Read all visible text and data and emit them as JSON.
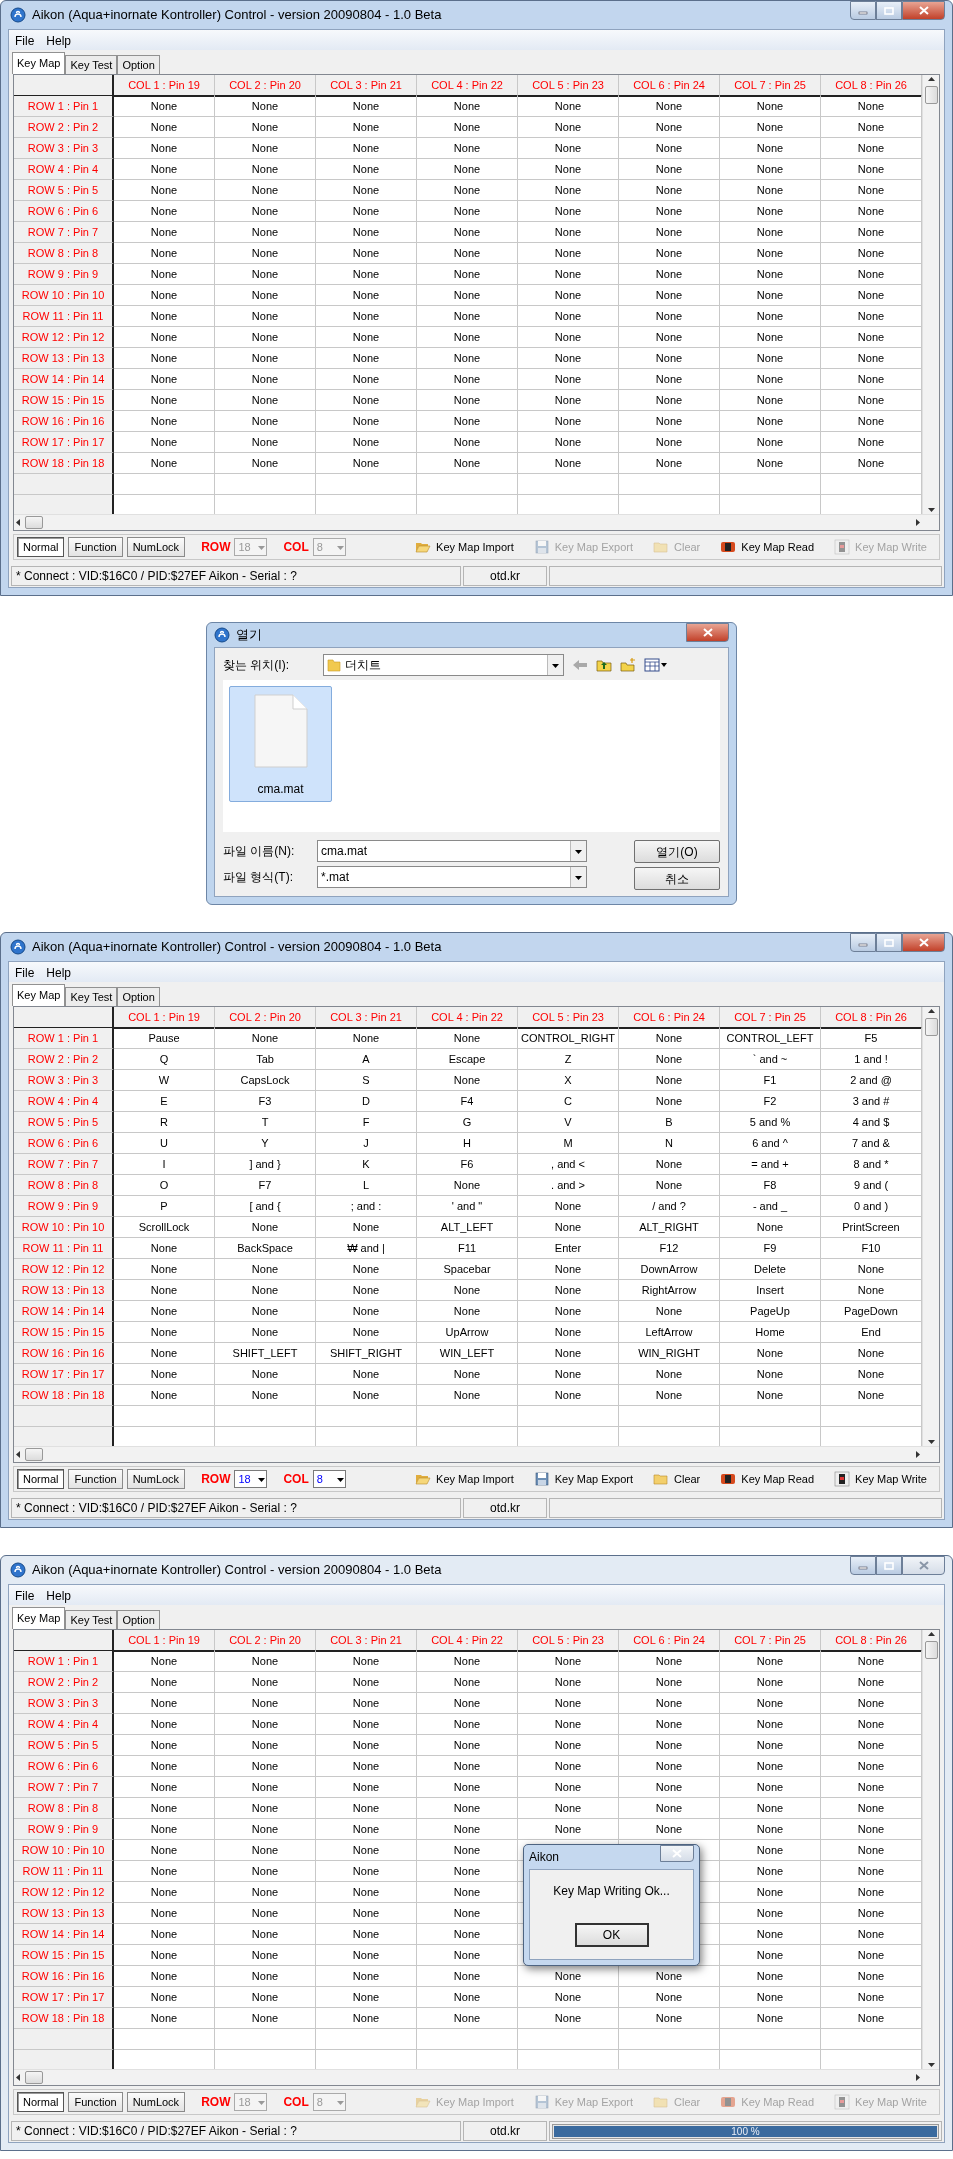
{
  "items": [
    {
      "kind": "window",
      "title": "Aikon (Aqua+inornate Kontroller) Control - version 20090804 - 1.0 Beta",
      "active": true,
      "menu": [
        "File",
        "Help"
      ],
      "tabs": [
        {
          "label": "Key Map",
          "selected": true
        },
        {
          "label": "Key Test",
          "selected": false
        },
        {
          "label": "Option",
          "selected": false
        }
      ],
      "columns": [
        "COL 1 : Pin 19",
        "COL 2 : Pin 20",
        "COL 3 : Pin 21",
        "COL 4 : Pin 22",
        "COL 5 : Pin 23",
        "COL 6 : Pin 24",
        "COL 7 : Pin 25",
        "COL 8 : Pin 26"
      ],
      "rows": [
        {
          "header": "ROW 1 : Pin 1",
          "cells": [
            "None",
            "None",
            "None",
            "None",
            "None",
            "None",
            "None",
            "None"
          ]
        },
        {
          "header": "ROW 2 : Pin 2",
          "cells": [
            "None",
            "None",
            "None",
            "None",
            "None",
            "None",
            "None",
            "None"
          ]
        },
        {
          "header": "ROW 3 : Pin 3",
          "cells": [
            "None",
            "None",
            "None",
            "None",
            "None",
            "None",
            "None",
            "None"
          ]
        },
        {
          "header": "ROW 4 : Pin 4",
          "cells": [
            "None",
            "None",
            "None",
            "None",
            "None",
            "None",
            "None",
            "None"
          ]
        },
        {
          "header": "ROW 5 : Pin 5",
          "cells": [
            "None",
            "None",
            "None",
            "None",
            "None",
            "None",
            "None",
            "None"
          ]
        },
        {
          "header": "ROW 6 : Pin 6",
          "cells": [
            "None",
            "None",
            "None",
            "None",
            "None",
            "None",
            "None",
            "None"
          ]
        },
        {
          "header": "ROW 7 : Pin 7",
          "cells": [
            "None",
            "None",
            "None",
            "None",
            "None",
            "None",
            "None",
            "None"
          ]
        },
        {
          "header": "ROW 8 : Pin 8",
          "cells": [
            "None",
            "None",
            "None",
            "None",
            "None",
            "None",
            "None",
            "None"
          ]
        },
        {
          "header": "ROW 9 : Pin 9",
          "cells": [
            "None",
            "None",
            "None",
            "None",
            "None",
            "None",
            "None",
            "None"
          ]
        },
        {
          "header": "ROW 10 : Pin 10",
          "cells": [
            "None",
            "None",
            "None",
            "None",
            "None",
            "None",
            "None",
            "None"
          ]
        },
        {
          "header": "ROW 11 : Pin 11",
          "cells": [
            "None",
            "None",
            "None",
            "None",
            "None",
            "None",
            "None",
            "None"
          ]
        },
        {
          "header": "ROW 12 : Pin 12",
          "cells": [
            "None",
            "None",
            "None",
            "None",
            "None",
            "None",
            "None",
            "None"
          ]
        },
        {
          "header": "ROW 13 : Pin 13",
          "cells": [
            "None",
            "None",
            "None",
            "None",
            "None",
            "None",
            "None",
            "None"
          ]
        },
        {
          "header": "ROW 14 : Pin 14",
          "cells": [
            "None",
            "None",
            "None",
            "None",
            "None",
            "None",
            "None",
            "None"
          ]
        },
        {
          "header": "ROW 15 : Pin 15",
          "cells": [
            "None",
            "None",
            "None",
            "None",
            "None",
            "None",
            "None",
            "None"
          ]
        },
        {
          "header": "ROW 16 : Pin 16",
          "cells": [
            "None",
            "None",
            "None",
            "None",
            "None",
            "None",
            "None",
            "None"
          ]
        },
        {
          "header": "ROW 17 : Pin 17",
          "cells": [
            "None",
            "None",
            "None",
            "None",
            "None",
            "None",
            "None",
            "None"
          ]
        },
        {
          "header": "ROW 18 : Pin 18",
          "cells": [
            "None",
            "None",
            "None",
            "None",
            "None",
            "None",
            "None",
            "None"
          ]
        }
      ],
      "modes": [
        {
          "label": "Normal",
          "selected": true
        },
        {
          "label": "Function",
          "selected": false
        },
        {
          "label": "NumLock",
          "selected": false
        }
      ],
      "row_select": {
        "label": "ROW",
        "value": "18",
        "disabled": true
      },
      "col_select": {
        "label": "COL",
        "value": "8",
        "disabled": true
      },
      "actions": [
        {
          "label": "Key Map Import",
          "kind": "folder-open",
          "disabled": false
        },
        {
          "label": "Key Map Export",
          "kind": "floppy",
          "disabled": true
        },
        {
          "label": "Clear",
          "kind": "folder",
          "disabled": true
        },
        {
          "label": "Key Map Read",
          "kind": "chip-red",
          "disabled": false
        },
        {
          "label": "Key Map Write",
          "kind": "chip",
          "disabled": true
        }
      ],
      "status": {
        "connection": "* Connect : VID:$16C0 / PID:$27EF Aikon - Serial : ?",
        "site": "otd.kr"
      }
    },
    {
      "kind": "open-dialog",
      "title": "열기",
      "location_label": "찾는 위치(I):",
      "location": "더치트",
      "files": [
        {
          "name": "cma.mat",
          "selected": true
        }
      ],
      "file_name_label": "파일 이름(N):",
      "file_name": "cma.mat",
      "file_type_label": "파일 형식(T):",
      "file_type": "*.mat",
      "buttons": [
        "열기(O)",
        "취소"
      ]
    },
    {
      "kind": "window",
      "title": "Aikon (Aqua+inornate Kontroller) Control - version 20090804 - 1.0 Beta",
      "active": true,
      "menu": [
        "File",
        "Help"
      ],
      "tabs": [
        {
          "label": "Key Map",
          "selected": true
        },
        {
          "label": "Key Test",
          "selected": false
        },
        {
          "label": "Option",
          "selected": false
        }
      ],
      "columns": [
        "COL 1 : Pin 19",
        "COL 2 : Pin 20",
        "COL 3 : Pin 21",
        "COL 4 : Pin 22",
        "COL 5 : Pin 23",
        "COL 6 : Pin 24",
        "COL 7 : Pin 25",
        "COL 8 : Pin 26"
      ],
      "rows": [
        {
          "header": "ROW 1 : Pin 1",
          "cells": [
            "Pause",
            "None",
            "None",
            "None",
            "CONTROL_RIGHT",
            "None",
            "CONTROL_LEFT",
            "F5"
          ]
        },
        {
          "header": "ROW 2 : Pin 2",
          "cells": [
            "Q",
            "Tab",
            "A",
            "Escape",
            "Z",
            "None",
            "` and ~",
            "1 and !"
          ]
        },
        {
          "header": "ROW 3 : Pin 3",
          "cells": [
            "W",
            "CapsLock",
            "S",
            "None",
            "X",
            "None",
            "F1",
            "2 and @"
          ]
        },
        {
          "header": "ROW 4 : Pin 4",
          "cells": [
            "E",
            "F3",
            "D",
            "F4",
            "C",
            "None",
            "F2",
            "3 and #"
          ]
        },
        {
          "header": "ROW 5 : Pin 5",
          "cells": [
            "R",
            "T",
            "F",
            "G",
            "V",
            "B",
            "5 and %",
            "4 and $"
          ]
        },
        {
          "header": "ROW 6 : Pin 6",
          "cells": [
            "U",
            "Y",
            "J",
            "H",
            "M",
            "N",
            "6 and ^",
            "7 and &"
          ]
        },
        {
          "header": "ROW 7 : Pin 7",
          "cells": [
            "I",
            "] and }",
            "K",
            "F6",
            ", and <",
            "None",
            "= and +",
            "8 and *"
          ]
        },
        {
          "header": "ROW 8 : Pin 8",
          "cells": [
            "O",
            "F7",
            "L",
            "None",
            ". and >",
            "None",
            "F8",
            "9 and ("
          ]
        },
        {
          "header": "ROW 9 : Pin 9",
          "cells": [
            "P",
            "[ and {",
            "; and :",
            "' and \"",
            "None",
            "/ and ?",
            "- and _",
            "0 and )"
          ]
        },
        {
          "header": "ROW 10 : Pin 10",
          "cells": [
            "ScrollLock",
            "None",
            "None",
            "ALT_LEFT",
            "None",
            "ALT_RIGHT",
            "None",
            "PrintScreen"
          ]
        },
        {
          "header": "ROW 11 : Pin 11",
          "cells": [
            "None",
            "BackSpace",
            "₩ and |",
            "F11",
            "Enter",
            "F12",
            "F9",
            "F10"
          ]
        },
        {
          "header": "ROW 12 : Pin 12",
          "cells": [
            "None",
            "None",
            "None",
            "Spacebar",
            "None",
            "DownArrow",
            "Delete",
            "None"
          ]
        },
        {
          "header": "ROW 13 : Pin 13",
          "cells": [
            "None",
            "None",
            "None",
            "None",
            "None",
            "RightArrow",
            "Insert",
            "None"
          ]
        },
        {
          "header": "ROW 14 : Pin 14",
          "cells": [
            "None",
            "None",
            "None",
            "None",
            "None",
            "None",
            "PageUp",
            "PageDown"
          ]
        },
        {
          "header": "ROW 15 : Pin 15",
          "cells": [
            "None",
            "None",
            "None",
            "UpArrow",
            "None",
            "LeftArrow",
            "Home",
            "End"
          ]
        },
        {
          "header": "ROW 16 : Pin 16",
          "cells": [
            "None",
            "SHIFT_LEFT",
            "SHIFT_RIGHT",
            "WIN_LEFT",
            "None",
            "WIN_RIGHT",
            "None",
            "None"
          ]
        },
        {
          "header": "ROW 17 : Pin 17",
          "cells": [
            "None",
            "None",
            "None",
            "None",
            "None",
            "None",
            "None",
            "None"
          ]
        },
        {
          "header": "ROW 18 : Pin 18",
          "cells": [
            "None",
            "None",
            "None",
            "None",
            "None",
            "None",
            "None",
            "None"
          ]
        }
      ],
      "modes": [
        {
          "label": "Normal",
          "selected": true
        },
        {
          "label": "Function",
          "selected": false
        },
        {
          "label": "NumLock",
          "selected": false
        }
      ],
      "row_select": {
        "label": "ROW",
        "value": "18",
        "disabled": false
      },
      "col_select": {
        "label": "COL",
        "value": "8",
        "disabled": false
      },
      "actions": [
        {
          "label": "Key Map Import",
          "kind": "folder-open",
          "disabled": false
        },
        {
          "label": "Key Map Export",
          "kind": "floppy",
          "disabled": false
        },
        {
          "label": "Clear",
          "kind": "folder",
          "disabled": false
        },
        {
          "label": "Key Map Read",
          "kind": "chip-red",
          "disabled": false
        },
        {
          "label": "Key Map Write",
          "kind": "chip",
          "disabled": false
        }
      ],
      "status": {
        "connection": "* Connect : VID:$16C0 / PID:$27EF Aikon - Serial : ?",
        "site": "otd.kr"
      }
    },
    {
      "kind": "window",
      "title": "Aikon (Aqua+inornate Kontroller) Control - version 20090804 - 1.0 Beta",
      "active": false,
      "menu": [
        "File",
        "Help"
      ],
      "tabs": [
        {
          "label": "Key Map",
          "selected": true
        },
        {
          "label": "Key Test",
          "selected": false
        },
        {
          "label": "Option",
          "selected": false
        }
      ],
      "columns": [
        "COL 1 : Pin 19",
        "COL 2 : Pin 20",
        "COL 3 : Pin 21",
        "COL 4 : Pin 22",
        "COL 5 : Pin 23",
        "COL 6 : Pin 24",
        "COL 7 : Pin 25",
        "COL 8 : Pin 26"
      ],
      "rows": [
        {
          "header": "ROW 1 : Pin 1",
          "cells": [
            "None",
            "None",
            "None",
            "None",
            "None",
            "None",
            "None",
            "None"
          ]
        },
        {
          "header": "ROW 2 : Pin 2",
          "cells": [
            "None",
            "None",
            "None",
            "None",
            "None",
            "None",
            "None",
            "None"
          ]
        },
        {
          "header": "ROW 3 : Pin 3",
          "cells": [
            "None",
            "None",
            "None",
            "None",
            "None",
            "None",
            "None",
            "None"
          ]
        },
        {
          "header": "ROW 4 : Pin 4",
          "cells": [
            "None",
            "None",
            "None",
            "None",
            "None",
            "None",
            "None",
            "None"
          ]
        },
        {
          "header": "ROW 5 : Pin 5",
          "cells": [
            "None",
            "None",
            "None",
            "None",
            "None",
            "None",
            "None",
            "None"
          ]
        },
        {
          "header": "ROW 6 : Pin 6",
          "cells": [
            "None",
            "None",
            "None",
            "None",
            "None",
            "None",
            "None",
            "None"
          ]
        },
        {
          "header": "ROW 7 : Pin 7",
          "cells": [
            "None",
            "None",
            "None",
            "None",
            "None",
            "None",
            "None",
            "None"
          ]
        },
        {
          "header": "ROW 8 : Pin 8",
          "cells": [
            "None",
            "None",
            "None",
            "None",
            "None",
            "None",
            "None",
            "None"
          ]
        },
        {
          "header": "ROW 9 : Pin 9",
          "cells": [
            "None",
            "None",
            "None",
            "None",
            "None",
            "None",
            "None",
            "None"
          ]
        },
        {
          "header": "ROW 10 : Pin 10",
          "cells": [
            "None",
            "None",
            "None",
            "None",
            null,
            null,
            "None",
            "None"
          ]
        },
        {
          "header": "ROW 11 : Pin 11",
          "cells": [
            "None",
            "None",
            "None",
            "None",
            null,
            null,
            "None",
            "None"
          ]
        },
        {
          "header": "ROW 12 : Pin 12",
          "cells": [
            "None",
            "None",
            "None",
            "None",
            null,
            null,
            "None",
            "None"
          ]
        },
        {
          "header": "ROW 13 : Pin 13",
          "cells": [
            "None",
            "None",
            "None",
            "None",
            null,
            null,
            "None",
            "None"
          ]
        },
        {
          "header": "ROW 14 : Pin 14",
          "cells": [
            "None",
            "None",
            "None",
            "None",
            null,
            null,
            "None",
            "None"
          ]
        },
        {
          "header": "ROW 15 : Pin 15",
          "cells": [
            "None",
            "None",
            "None",
            "None",
            null,
            null,
            "None",
            "None"
          ]
        },
        {
          "header": "ROW 16 : Pin 16",
          "cells": [
            "None",
            "None",
            "None",
            "None",
            "None",
            "None",
            "None",
            "None"
          ]
        },
        {
          "header": "ROW 17 : Pin 17",
          "cells": [
            "None",
            "None",
            "None",
            "None",
            "None",
            "None",
            "None",
            "None"
          ]
        },
        {
          "header": "ROW 18 : Pin 18",
          "cells": [
            "None",
            "None",
            "None",
            "None",
            "None",
            "None",
            "None",
            "None"
          ]
        }
      ],
      "modes": [
        {
          "label": "Normal",
          "selected": true
        },
        {
          "label": "Function",
          "selected": false
        },
        {
          "label": "NumLock",
          "selected": false
        }
      ],
      "row_select": {
        "label": "ROW",
        "value": "18",
        "disabled": true
      },
      "col_select": {
        "label": "COL",
        "value": "8",
        "disabled": true
      },
      "actions": [
        {
          "label": "Key Map Import",
          "kind": "folder-open",
          "disabled": true
        },
        {
          "label": "Key Map Export",
          "kind": "floppy",
          "disabled": true
        },
        {
          "label": "Clear",
          "kind": "folder",
          "disabled": true
        },
        {
          "label": "Key Map Read",
          "kind": "chip-red",
          "disabled": true
        },
        {
          "label": "Key Map Write",
          "kind": "chip",
          "disabled": true
        }
      ],
      "status": {
        "connection": "* Connect : VID:$16C0 / PID:$27EF Aikon - Serial : ?",
        "site": "otd.kr"
      },
      "progress": {
        "level": 1,
        "text": "100 %"
      },
      "message_box": {
        "title": "Aikon",
        "message": "Key Map Writing Ok...",
        "button": "OK"
      }
    }
  ]
}
